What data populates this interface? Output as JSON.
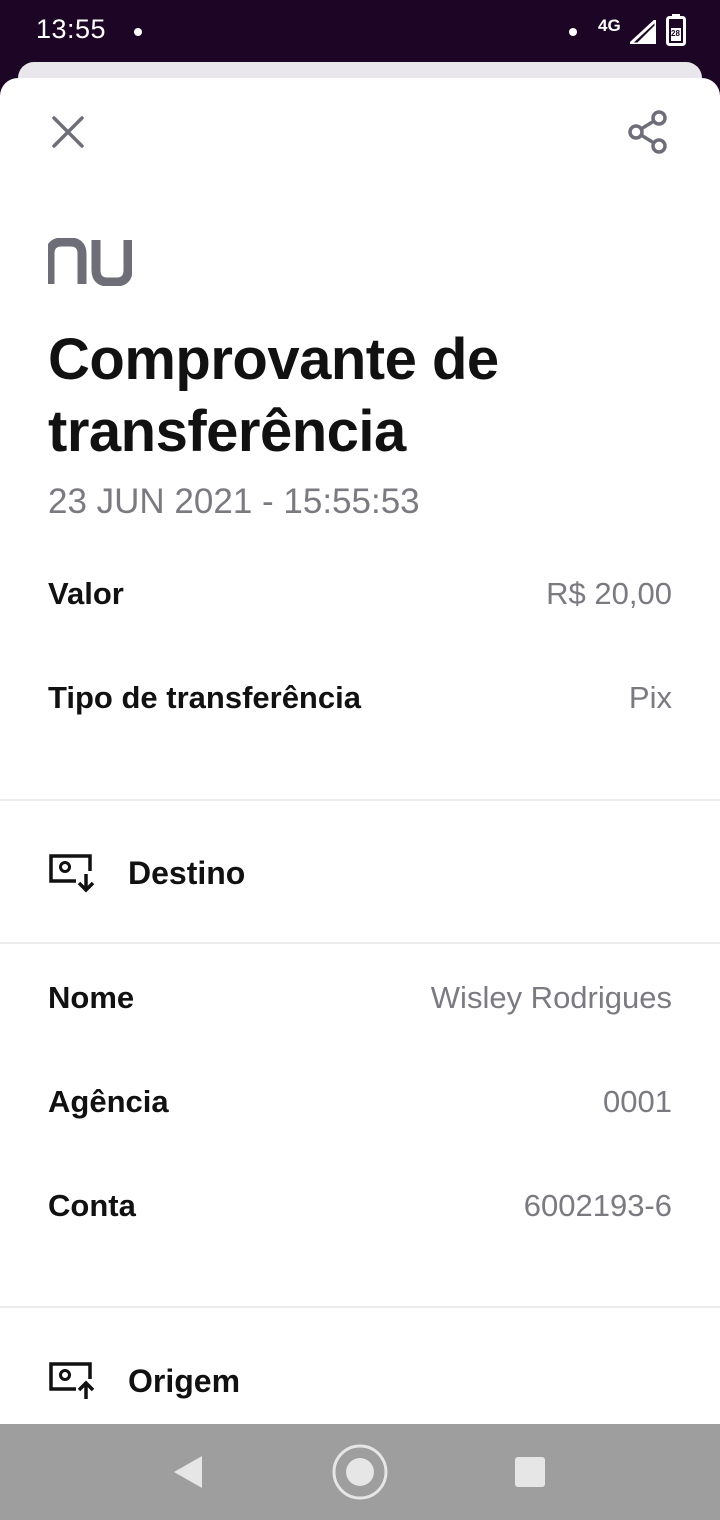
{
  "status_bar": {
    "time": "13:55",
    "network": "4G",
    "battery_level": "28"
  },
  "header": {
    "close_icon": "close-icon",
    "share_icon": "share-icon",
    "logo_icon": "nu-logo"
  },
  "receipt": {
    "title": "Comprovante de transferência",
    "datetime": "23 JUN 2021 - 15:55:53",
    "valor_label": "Valor",
    "valor_value": "R$ 20,00",
    "tipo_label": "Tipo de transferência",
    "tipo_value": "Pix"
  },
  "destino": {
    "section_label": "Destino",
    "icon": "account-download-icon",
    "nome_label": "Nome",
    "nome_value": "Wisley Rodrigues",
    "agencia_label": "Agência",
    "agencia_value": "0001",
    "conta_label": "Conta",
    "conta_value": "6002193-6"
  },
  "origem": {
    "section_label": "Origem",
    "icon": "account-upload-icon"
  },
  "nav": {
    "back_icon": "back-triangle-icon",
    "home_icon": "home-circle-icon",
    "recents_icon": "recents-square-icon"
  },
  "colors": {
    "status_bar_bg": "#1d0525",
    "logo": "#6e6e78",
    "text_primary": "#111111",
    "text_secondary": "#7a7a80",
    "nav_bg": "#9e9e9e"
  }
}
